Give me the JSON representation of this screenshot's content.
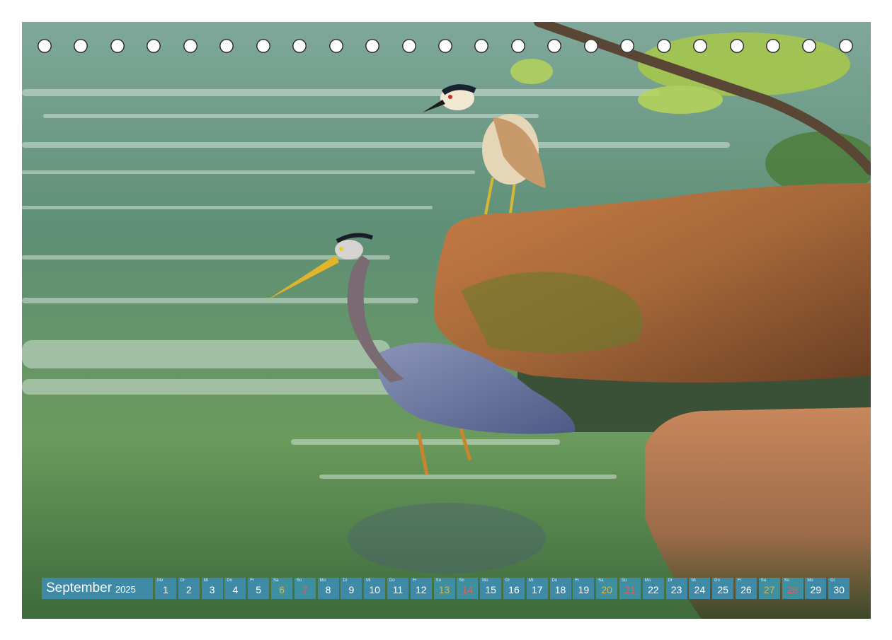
{
  "calendar": {
    "month": "September",
    "year": "2025",
    "days": [
      {
        "wd": "Mo",
        "d": "1",
        "type": "weekday"
      },
      {
        "wd": "Di",
        "d": "2",
        "type": "weekday"
      },
      {
        "wd": "Mi",
        "d": "3",
        "type": "weekday"
      },
      {
        "wd": "Do",
        "d": "4",
        "type": "weekday"
      },
      {
        "wd": "Fr",
        "d": "5",
        "type": "weekday"
      },
      {
        "wd": "Sa",
        "d": "6",
        "type": "saturday"
      },
      {
        "wd": "So",
        "d": "7",
        "type": "sunday"
      },
      {
        "wd": "Mo",
        "d": "8",
        "type": "weekday"
      },
      {
        "wd": "Di",
        "d": "9",
        "type": "weekday"
      },
      {
        "wd": "Mi",
        "d": "10",
        "type": "weekday"
      },
      {
        "wd": "Do",
        "d": "11",
        "type": "weekday"
      },
      {
        "wd": "Fr",
        "d": "12",
        "type": "weekday"
      },
      {
        "wd": "Sa",
        "d": "13",
        "type": "saturday"
      },
      {
        "wd": "So",
        "d": "14",
        "type": "sunday"
      },
      {
        "wd": "Mo",
        "d": "15",
        "type": "weekday"
      },
      {
        "wd": "Di",
        "d": "16",
        "type": "weekday"
      },
      {
        "wd": "Mi",
        "d": "17",
        "type": "weekday"
      },
      {
        "wd": "Do",
        "d": "18",
        "type": "weekday"
      },
      {
        "wd": "Fr",
        "d": "19",
        "type": "weekday"
      },
      {
        "wd": "Sa",
        "d": "20",
        "type": "saturday"
      },
      {
        "wd": "So",
        "d": "21",
        "type": "sunday"
      },
      {
        "wd": "Mo",
        "d": "22",
        "type": "weekday"
      },
      {
        "wd": "Di",
        "d": "23",
        "type": "weekday"
      },
      {
        "wd": "Mi",
        "d": "24",
        "type": "weekday"
      },
      {
        "wd": "Do",
        "d": "25",
        "type": "weekday"
      },
      {
        "wd": "Fr",
        "d": "26",
        "type": "weekday"
      },
      {
        "wd": "Sa",
        "d": "27",
        "type": "saturday"
      },
      {
        "wd": "So",
        "d": "28",
        "type": "sunday"
      },
      {
        "wd": "Mo",
        "d": "29",
        "type": "weekday"
      },
      {
        "wd": "Di",
        "d": "30",
        "type": "weekday"
      }
    ]
  },
  "binding": {
    "hole_count": 23
  },
  "colors": {
    "bar_bg": "#3f8aa6",
    "saturday": "#e0b64a",
    "sunday": "#e06060",
    "water": "#5f8f6c",
    "rock": "#b86f3c"
  }
}
